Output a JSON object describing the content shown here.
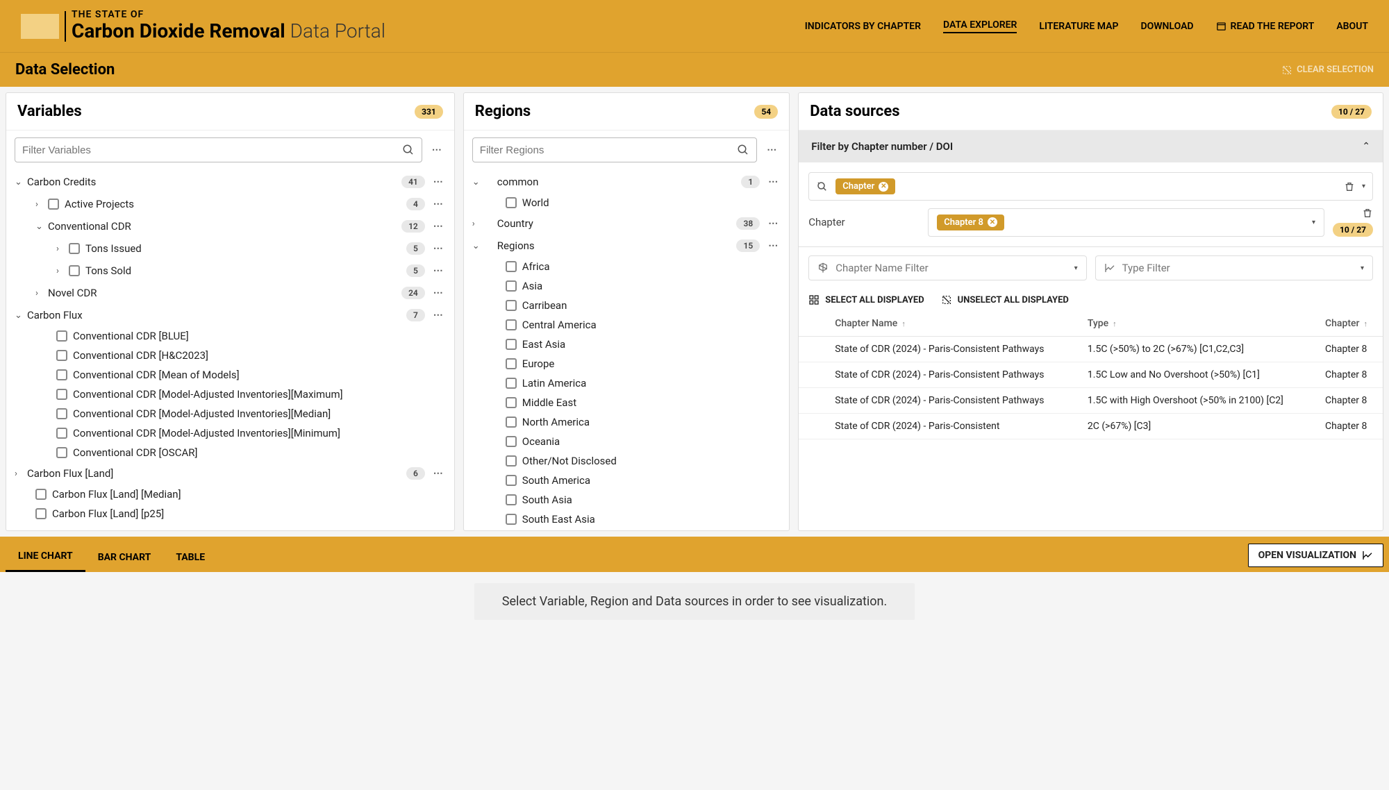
{
  "header": {
    "logo_line1": "THE STATE OF",
    "logo_line2a": "Carbon Dioxide Removal",
    "logo_line2b": "Data Portal",
    "nav": {
      "indicators": "INDICATORS BY CHAPTER",
      "explorer": "DATA EXPLORER",
      "literature": "LITERATURE MAP",
      "download": "DOWNLOAD",
      "read_report": "READ THE REPORT",
      "about": "ABOUT"
    }
  },
  "subheader": {
    "title": "Data Selection",
    "clear": "CLEAR SELECTION"
  },
  "variables": {
    "title": "Variables",
    "count": "331",
    "search_placeholder": "Filter Variables",
    "tree": {
      "g0": {
        "label": "Carbon Credits",
        "count": "41"
      },
      "g0a": {
        "label": "Active Projects",
        "count": "4"
      },
      "g0b": {
        "label": "Conventional CDR",
        "count": "12"
      },
      "g0b1": {
        "label": "Tons Issued",
        "count": "5"
      },
      "g0b2": {
        "label": "Tons Sold",
        "count": "5"
      },
      "g0c": {
        "label": "Novel CDR",
        "count": "24"
      },
      "g1": {
        "label": "Carbon Flux",
        "count": "7"
      },
      "g1a": {
        "label": "Conventional CDR [BLUE]"
      },
      "g1b": {
        "label": "Conventional CDR [H&C2023]"
      },
      "g1c": {
        "label": "Conventional CDR [Mean of Models]"
      },
      "g1d": {
        "label": "Conventional CDR [Model-Adjusted Inventories][Maximum]"
      },
      "g1e": {
        "label": "Conventional CDR [Model-Adjusted Inventories][Median]"
      },
      "g1f": {
        "label": "Conventional CDR [Model-Adjusted Inventories][Minimum]"
      },
      "g1g": {
        "label": "Conventional CDR [OSCAR]"
      },
      "g2": {
        "label": "Carbon Flux [Land]",
        "count": "6"
      },
      "g2a": {
        "label": "Carbon Flux [Land] [Median]"
      },
      "g2b": {
        "label": "Carbon Flux [Land] [p25]"
      }
    }
  },
  "regions": {
    "title": "Regions",
    "count": "54",
    "search_placeholder": "Filter Regions",
    "groups": {
      "common": {
        "label": "common",
        "count": "1"
      },
      "world": "World",
      "country": {
        "label": "Country",
        "count": "38"
      },
      "regions": {
        "label": "Regions",
        "count": "15"
      }
    },
    "region_list": {
      "r0": "Africa",
      "r1": "Asia",
      "r2": "Carribean",
      "r3": "Central America",
      "r4": "East Asia",
      "r5": "Europe",
      "r6": "Latin America",
      "r7": "Middle East",
      "r8": "North America",
      "r9": "Oceania",
      "r10": "Other/Not Disclosed",
      "r11": "South America",
      "r12": "South Asia",
      "r13": "South East Asia"
    }
  },
  "datasources": {
    "title": "Data sources",
    "count": "10 / 27",
    "filter_head": "Filter by Chapter number / DOI",
    "chip1": "Chapter",
    "row2_label": "Chapter",
    "chip2": "Chapter 8",
    "chapter_filter": "Chapter Name Filter",
    "type_filter": "Type Filter",
    "select_all": "SELECT ALL DISPLAYED",
    "unselect_all": "UNSELECT ALL DISPLAYED",
    "th": {
      "name": "Chapter Name",
      "type": "Type",
      "chapter": "Chapter"
    },
    "rows": {
      "r0": {
        "name": "State of CDR (2024) - Paris-Consistent Pathways",
        "type": "1.5C (>50%) to 2C (>67%) [C1,C2,C3]",
        "chapter": "Chapter 8"
      },
      "r1": {
        "name": "State of CDR (2024) - Paris-Consistent Pathways",
        "type": "1.5C Low and No Overshoot (>50%) [C1]",
        "chapter": "Chapter 8"
      },
      "r2": {
        "name": "State of CDR (2024) - Paris-Consistent Pathways",
        "type": "1.5C with High Overshoot (>50% in 2100) [C2]",
        "chapter": "Chapter 8"
      },
      "r3": {
        "name": "State of CDR (2024) - Paris-Consistent",
        "type": "2C (>67%) [C3]",
        "chapter": "Chapter 8"
      }
    }
  },
  "bottom": {
    "line": "LINE CHART",
    "bar": "BAR CHART",
    "table": "TABLE",
    "open": "OPEN VISUALIZATION"
  },
  "hint": "Select Variable, Region and Data sources in order to see visualization."
}
